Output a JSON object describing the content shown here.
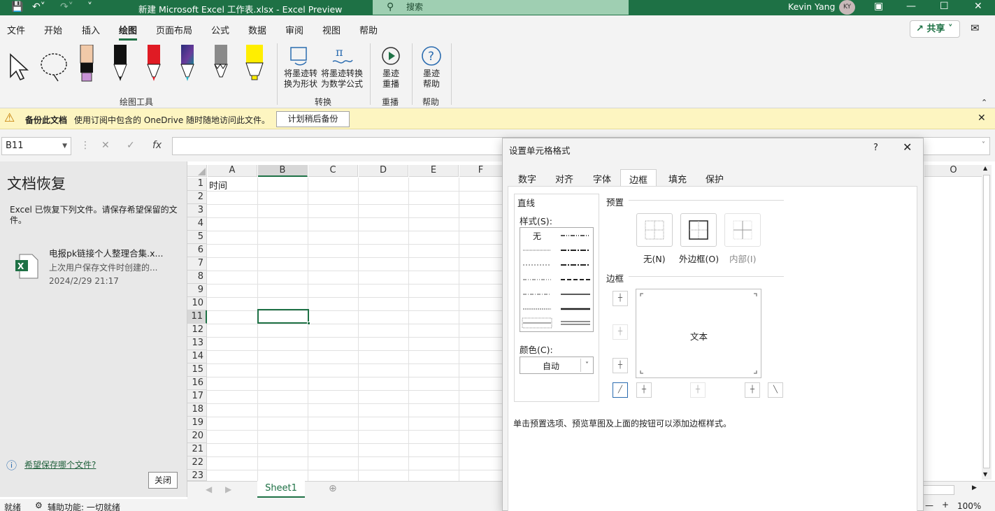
{
  "titlebar": {
    "title": "新建 Microsoft Excel 工作表.xlsx  -  Excel Preview",
    "search_placeholder": "搜索",
    "user_name": "Kevin Yang",
    "user_initials": "KY"
  },
  "menu": {
    "tabs": [
      "文件",
      "开始",
      "插入",
      "绘图",
      "页面布局",
      "公式",
      "数据",
      "审阅",
      "视图",
      "帮助"
    ],
    "active": "绘图",
    "share_label": "共享"
  },
  "ribbon": {
    "drawing_tools_label": "绘图工具",
    "convert_label": "转换",
    "replay_label": "重播",
    "help_label": "帮助",
    "ink_to_shape": "将墨迹转换为形状",
    "ink_to_math": "将墨迹转换为数学公式",
    "ink_replay": "墨迹重播",
    "ink_help": "墨迹帮助",
    "colors": {
      "pen_black": "#111111",
      "pen_red": "#e01b24",
      "pen_galaxy": "#3b3f9b",
      "pencil_gray": "#8a8a8a",
      "highlighter_yellow": "#ffee00",
      "highlighter_pink": "#f1c9a8"
    }
  },
  "infobar": {
    "bold": "备份此文档",
    "message": "使用订阅中包含的 OneDrive 随时随地访问此文件。",
    "button": "计划稍后备份"
  },
  "formulabar": {
    "namebox": "B11",
    "fx": "fx"
  },
  "recovery": {
    "title": "文档恢复",
    "desc": "Excel 已恢复下列文件。请保存希望保留的文件。",
    "file_name": "电报pk链接个人整理合集.x...",
    "file_desc": "上次用户保存文件时创建的...",
    "file_date": "2024/2/29 21:17",
    "help_link": "希望保存哪个文件?",
    "close_btn": "关闭"
  },
  "grid": {
    "columns": [
      "A",
      "B",
      "C",
      "D",
      "E",
      "F",
      "O"
    ],
    "rows": [
      "1",
      "2",
      "3",
      "4",
      "5",
      "6",
      "7",
      "8",
      "9",
      "10",
      "11",
      "12",
      "13",
      "14",
      "15",
      "16",
      "17",
      "18",
      "19",
      "20",
      "21",
      "22",
      "23"
    ],
    "a1_value": "时间",
    "selected_cell": "B11"
  },
  "sheet": {
    "tab": "Sheet1"
  },
  "status": {
    "ready": "就绪",
    "accessibility": "辅助功能: 一切就绪",
    "zoom": "100%"
  },
  "dialog": {
    "title": "设置单元格格式",
    "help": "?",
    "tabs": [
      "数字",
      "对齐",
      "字体",
      "边框",
      "填充",
      "保护"
    ],
    "active_tab": "边框",
    "line_section": "直线",
    "style_label": "样式(S):",
    "style_none": "无",
    "color_label": "颜色(C):",
    "color_value": "自动",
    "preset_section": "预置",
    "preset_none": "无(N)",
    "preset_outline": "外边框(O)",
    "preset_inside": "内部(I)",
    "border_section": "边框",
    "preview_text": "文本",
    "hint": "单击预置选项、预览草图及上面的按钮可以添加边框样式。"
  }
}
